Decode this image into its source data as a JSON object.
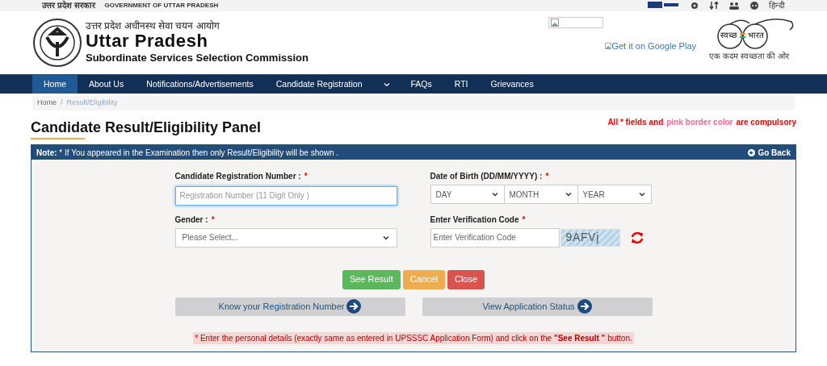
{
  "top_bar": {
    "left_hindi": "उत्तर प्रदेश सरकार",
    "left_english": "GOVERNMENT OF UTTAR PRADESH",
    "language": "हिन्दी"
  },
  "header": {
    "title_hindi": "उत्तर प्रदेश अधीनस्थ सेवा चयन आयोग",
    "title": "Uttar Pradesh",
    "subtitle": "Subordinate Services Selection Commission",
    "play_store": "Get it on Google Play",
    "swachh_left": "स्वच्छ",
    "swachh_right": "भारत",
    "swachh_tagline": "एक कदम स्वच्छता की ओर"
  },
  "nav": [
    {
      "label": "Home",
      "selected": true,
      "dropdown": false
    },
    {
      "label": "About Us",
      "selected": false,
      "dropdown": false
    },
    {
      "label": "Notifications/Advertisements",
      "selected": false,
      "dropdown": false
    },
    {
      "label": "Candidate Registration",
      "selected": false,
      "dropdown": true
    },
    {
      "label": "FAQs",
      "selected": false,
      "dropdown": false
    },
    {
      "label": "RTI",
      "selected": false,
      "dropdown": false
    },
    {
      "label": "Grievances",
      "selected": false,
      "dropdown": false
    }
  ],
  "breadcrumb": [
    "Home",
    "Result/Eligibility"
  ],
  "breadcrumb_separator": "/",
  "page_title": "Candidate Result/Eligibility Panel",
  "compulsory_note": [
    {
      "text": "All * fields and",
      "color": "#ff0000"
    },
    {
      "text": "pink border color",
      "color": "#ff6699"
    },
    {
      "text": "are compulsory",
      "color": "#ff0000"
    }
  ],
  "panel": {
    "note": "**Note:** * If You appeared in the Examination then only Result/Eligibility will be shown .",
    "go_back": "Go Back"
  },
  "form": {
    "registration": {
      "label": "Candidate Registration Number :",
      "placeholder": "Registration Number (11 Digit Only )"
    },
    "dob": {
      "label": "Date of Birth (DD/MM/YYYY) :",
      "selects": [
        "DAY",
        "MONTH",
        "YEAR"
      ]
    },
    "gender": {
      "label": "Gender :",
      "value": "Please Select..."
    },
    "verification": {
      "label": "Enter Verification Code",
      "placeholder": "Enter Verification Code",
      "captcha": "9AFVj"
    },
    "required_mark": "*"
  },
  "buttons": [
    {
      "label": "See Result",
      "kind": "success"
    },
    {
      "label": "Cancel",
      "kind": "warning"
    },
    {
      "label": "Close",
      "kind": "danger"
    }
  ],
  "links": [
    "Know your Registration Number",
    "View Application Status"
  ],
  "footer_note": "* Enter the personal details (exactly same as entered in UPSSSC Application Form) and click on the **\"See Result \"** button."
}
